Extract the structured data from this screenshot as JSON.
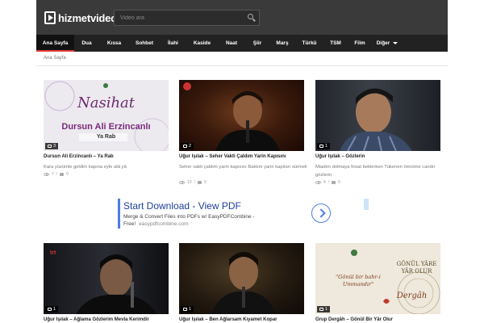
{
  "header": {
    "logo_text": "hizmetvideo",
    "search_placeholder": "Video ara"
  },
  "nav": {
    "items": [
      {
        "label": "Ana Sayfa",
        "active": true
      },
      {
        "label": "Dua"
      },
      {
        "label": "Kıssa"
      },
      {
        "label": "Sohbet"
      },
      {
        "label": "İlahi"
      },
      {
        "label": "Kaside"
      },
      {
        "label": "Naat"
      },
      {
        "label": "Şiir"
      },
      {
        "label": "Marş"
      },
      {
        "label": "Türkü"
      },
      {
        "label": "TSM"
      },
      {
        "label": "Film"
      },
      {
        "label": "Diğer"
      }
    ]
  },
  "breadcrumb": "Ana Sayfa",
  "videos": [
    {
      "count": "3",
      "title": "Dursun Ali Erzincanlı – Ya Rab",
      "excerpt": "Kara yüzümle geldim kapına eyle atâ yâ",
      "views": "7",
      "comments": "0",
      "thumb_text": {
        "script": "Nasihat",
        "name": "Dursun Ali Erzincanlı",
        "sub": "Ya Rab"
      }
    },
    {
      "count": "2",
      "title": "Uğur Işılak – Seher Vakti Çaldım Yarin Kapısını",
      "excerpt": "Seher vakti çaldım yarin kapısını Baktım yarin kapıları sürmeli",
      "views": "10",
      "comments": "0"
    },
    {
      "count": "1",
      "title": "Uğur Işılak – Gözlerin",
      "excerpt": "Miadım dolmaya fırsat beklerken Tükenen ömrüme candır gözlerin",
      "views": "4",
      "comments": "0"
    },
    {
      "count": "1",
      "title": "Uğur Işılak – Ağlama Gözlerim Mevla Kerimdir"
    },
    {
      "count": "1",
      "title": "Uğur Işılak – Ben Ağlarsam Kıyamet Kopar"
    },
    {
      "count": "1",
      "title": "Grup Dergâh – Gönül Bir Yâr Olur",
      "thumb_text": {
        "quote": "\"Gönül bir bahr-i Ummandır\"",
        "side": "GÖNÜL YÂRE YÂR OLUR",
        "brand": "Dergâh"
      }
    }
  ],
  "ad": {
    "title": "Start Download - View PDF",
    "line1": "Merge & Convert Files into PDFs w/ EasyPDFCombine -",
    "line2": "Free!",
    "url": "easypdfcombine.com"
  },
  "colors": {
    "header_bg": "#3a3a3a",
    "nav_bg": "#222222",
    "accent": "#e23a3a",
    "ad_blue": "#1e3f9a"
  }
}
